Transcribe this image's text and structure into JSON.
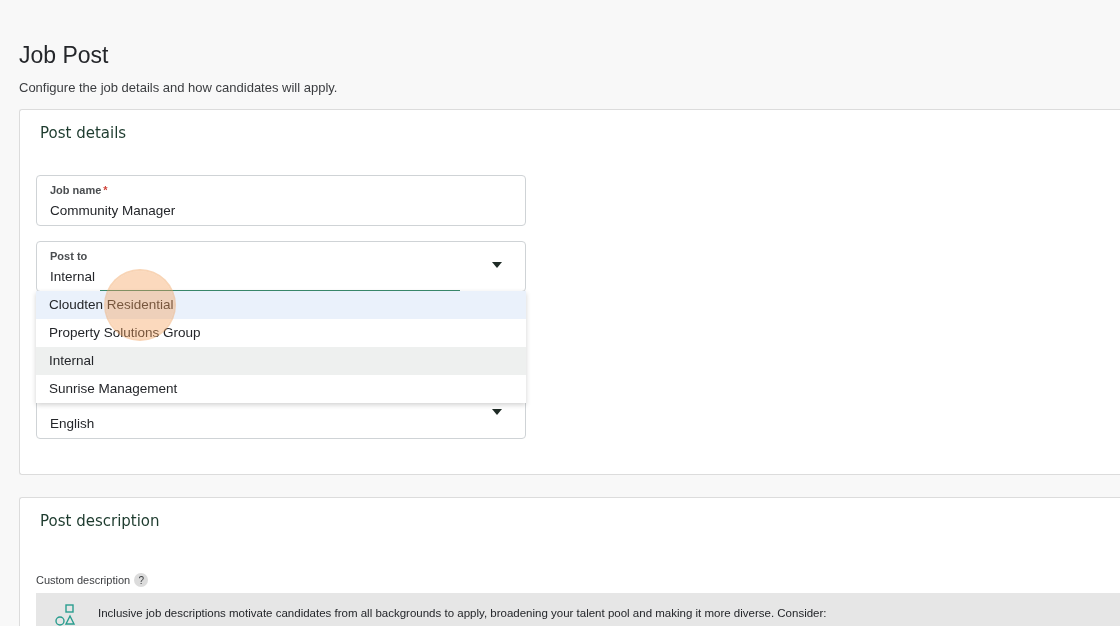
{
  "page": {
    "title": "Job Post",
    "subtitle": "Configure the job details and how candidates will apply."
  },
  "post_details": {
    "title": "Post details",
    "job_name": {
      "label": "Job name",
      "required_mark": "*",
      "value": "Community Manager"
    },
    "post_to": {
      "label": "Post to",
      "value": "Internal",
      "expanded": true,
      "options": [
        {
          "label": "Cloudten Residential",
          "selected": false,
          "hovered": true
        },
        {
          "label": "Property Solutions Group",
          "selected": false,
          "hovered": false
        },
        {
          "label": "Internal",
          "selected": true,
          "hovered": false
        },
        {
          "label": "Sunrise Management",
          "selected": false,
          "hovered": false
        }
      ]
    },
    "application_language": {
      "value": "English"
    }
  },
  "post_description": {
    "title": "Post description",
    "custom_label": "Custom description",
    "help": "?",
    "banner": "Inclusive job descriptions motivate candidates from all backgrounds to apply, broadening your talent pool and making it more diverse. Consider:"
  }
}
